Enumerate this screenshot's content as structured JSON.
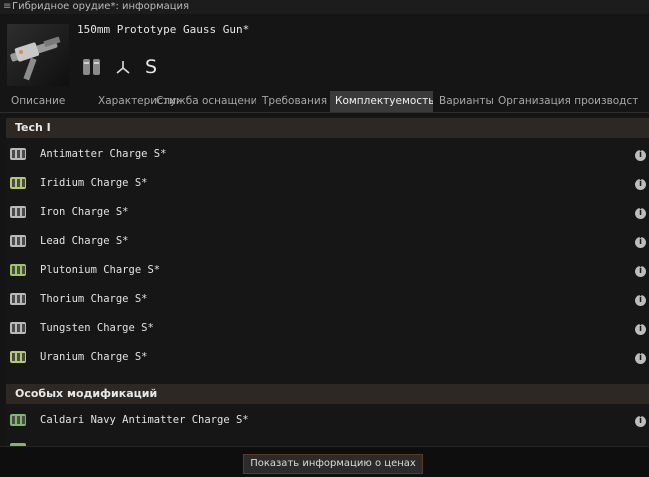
{
  "window": {
    "title": "Гибридное орудие*: информация"
  },
  "header": {
    "item_name": "150mm Prototype Gauss Gun*",
    "size_label": "S",
    "icons": [
      "gun-thumbnail",
      "ammo-icon",
      "turret-icon"
    ]
  },
  "tabs": [
    {
      "label": "Описание"
    },
    {
      "label": "Характеристики"
    },
    {
      "label": "Служба оснащения"
    },
    {
      "label": "Требования"
    },
    {
      "label": "Комплектуемость с",
      "active": true
    },
    {
      "label": "Варианты"
    },
    {
      "label": "Организация производства"
    }
  ],
  "sections": [
    {
      "title": "Tech I",
      "items": [
        {
          "name": "Antimatter Charge S*",
          "icon_color": "#b9b9b9"
        },
        {
          "name": "Iridium Charge S*",
          "icon_color": "#b5c872"
        },
        {
          "name": "Iron Charge S*",
          "icon_color": "#b9b9b9"
        },
        {
          "name": "Lead Charge S*",
          "icon_color": "#b9b9b9"
        },
        {
          "name": "Plutonium Charge S*",
          "icon_color": "#9fc85a"
        },
        {
          "name": "Thorium Charge S*",
          "icon_color": "#b9b9b9"
        },
        {
          "name": "Tungsten Charge S*",
          "icon_color": "#b9b9b9"
        },
        {
          "name": "Uranium Charge S*",
          "icon_color": "#b5c872"
        }
      ]
    },
    {
      "title": "Особых модификаций",
      "items": [
        {
          "name": "Caldari Navy Antimatter Charge S*",
          "icon_color": "#7fb86a"
        }
      ]
    }
  ],
  "footer": {
    "price_button_label": "Показать информацию о ценах"
  },
  "colors": {
    "background": "#141414",
    "section_header": "#2e2824",
    "active_tab": "#3a3a3a",
    "info_icon": "#bdbdbd"
  }
}
